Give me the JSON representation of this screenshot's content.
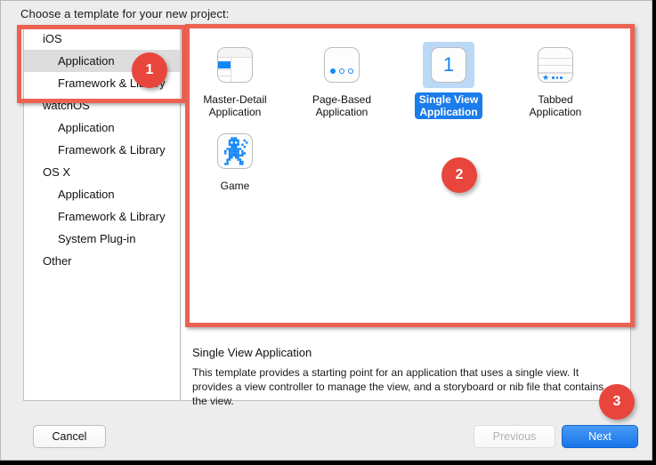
{
  "window": {
    "title": "Choose a template for your new project:"
  },
  "sidebar": {
    "items": [
      {
        "label": "iOS",
        "level": "group",
        "selected": false
      },
      {
        "label": "Application",
        "level": "child",
        "selected": true
      },
      {
        "label": "Framework & Library",
        "level": "child",
        "selected": false
      },
      {
        "label": "watchOS",
        "level": "group",
        "selected": false
      },
      {
        "label": "Application",
        "level": "child",
        "selected": false
      },
      {
        "label": "Framework & Library",
        "level": "child",
        "selected": false
      },
      {
        "label": "OS X",
        "level": "group",
        "selected": false
      },
      {
        "label": "Application",
        "level": "child",
        "selected": false
      },
      {
        "label": "Framework & Library",
        "level": "child",
        "selected": false
      },
      {
        "label": "System Plug-in",
        "level": "child",
        "selected": false
      },
      {
        "label": "Other",
        "level": "group",
        "selected": false
      }
    ]
  },
  "templates": [
    {
      "label": "Master-Detail\nApplication",
      "icon": "master-detail-icon",
      "selected": false
    },
    {
      "label": "Page-Based\nApplication",
      "icon": "page-based-icon",
      "selected": false
    },
    {
      "label": "Single View\nApplication",
      "icon": "single-view-icon",
      "selected": true
    },
    {
      "label": "Tabbed\nApplication",
      "icon": "tabbed-icon",
      "selected": false
    },
    {
      "label": "Game",
      "icon": "game-icon",
      "selected": false
    }
  ],
  "description": {
    "title": "Single View Application",
    "body": "This template provides a starting point for an application that uses a single view. It provides a view controller to manage the view, and a storyboard or nib file that contains the view."
  },
  "buttons": {
    "cancel": "Cancel",
    "previous": "Previous",
    "next": "Next"
  },
  "annotations": {
    "badges": [
      {
        "number": "1"
      },
      {
        "number": "2"
      },
      {
        "number": "3"
      }
    ],
    "accent_color": "#ec6252",
    "badge_color": "#e8453c"
  },
  "colors": {
    "selection_blue": "#1b7ceb",
    "selection_blue_light": "#bcd8f7",
    "sidebar_selection_gray": "#dcdcdc",
    "icon_blue": "#1287f5"
  }
}
